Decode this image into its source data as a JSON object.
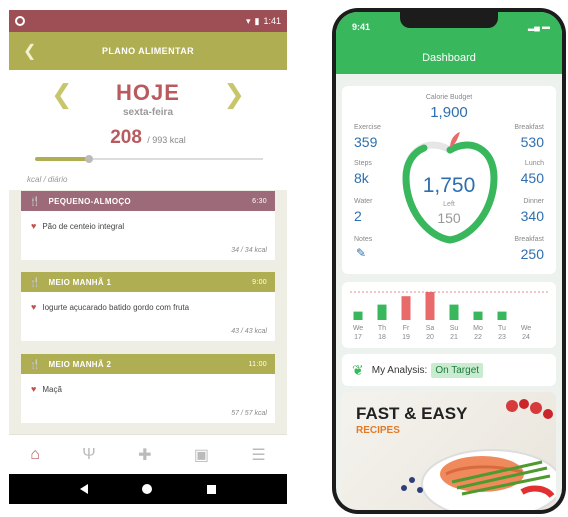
{
  "android": {
    "status_time": "1:41",
    "title": "PLANO ALIMENTAR",
    "day_label": "HOJE",
    "weekday": "sexta-feira",
    "calories_current": "208",
    "calories_target": "/ 993 kcal",
    "calorie_progress": 0.23,
    "unit_label": "kcal / diário",
    "meals": [
      {
        "name": "PEQUENO-ALMOÇO",
        "time": "6:30",
        "color": "#9d6a7a",
        "item": "Pão de centeio integral",
        "total": "34 / 34 kcal"
      },
      {
        "name": "MEIO MANHÃ 1",
        "time": "9:00",
        "color": "#b0ae52",
        "item": "Iogurte açucarado batido gordo com fruta",
        "total": "43 / 43 kcal"
      },
      {
        "name": "MEIO MANHÃ 2",
        "time": "11:00",
        "color": "#b0ae52",
        "item": "Maçã",
        "total": "57 / 57 kcal"
      }
    ],
    "bottom_nav": [
      "home-icon",
      "utensils-icon",
      "plus-icon",
      "calendar-icon",
      "list-icon"
    ],
    "accent": "#b85a5e"
  },
  "iphone": {
    "time": "9:41",
    "title": "Dashboard",
    "calorie_budget_label": "Calorie Budget",
    "calorie_budget": "1,900",
    "remaining": "1,750",
    "left_label": "Left",
    "left_value": "150",
    "left_stats": [
      {
        "label": "Exercise",
        "value": "359"
      },
      {
        "label": "Steps",
        "value": "8k"
      },
      {
        "label": "Water",
        "value": "2"
      },
      {
        "label": "Notes",
        "value": ""
      }
    ],
    "right_stats": [
      {
        "label": "Breakfast",
        "value": "530"
      },
      {
        "label": "Lunch",
        "value": "450"
      },
      {
        "label": "Dinner",
        "value": "340"
      },
      {
        "label": "Breakfast",
        "value": "250"
      }
    ],
    "week": [
      {
        "d": "We",
        "n": "17",
        "h": 0.3,
        "c": "#38b75c"
      },
      {
        "d": "Th",
        "n": "18",
        "h": 0.55,
        "c": "#38b75c"
      },
      {
        "d": "Fr",
        "n": "19",
        "h": 0.85,
        "c": "#e86a6a"
      },
      {
        "d": "Sa",
        "n": "20",
        "h": 1.0,
        "c": "#e86a6a"
      },
      {
        "d": "Su",
        "n": "21",
        "h": 0.55,
        "c": "#38b75c"
      },
      {
        "d": "Mo",
        "n": "22",
        "h": 0.3,
        "c": "#38b75c"
      },
      {
        "d": "Tu",
        "n": "23",
        "h": 0.3,
        "c": "#38b75c"
      },
      {
        "d": "We",
        "n": "24",
        "h": 0,
        "c": "#38b75c"
      }
    ],
    "analysis_label": "My Analysis:",
    "analysis_status": "On Target",
    "promo_title": "FAST & EASY",
    "promo_sub": "RECIPES",
    "accent": "#38b75c"
  }
}
